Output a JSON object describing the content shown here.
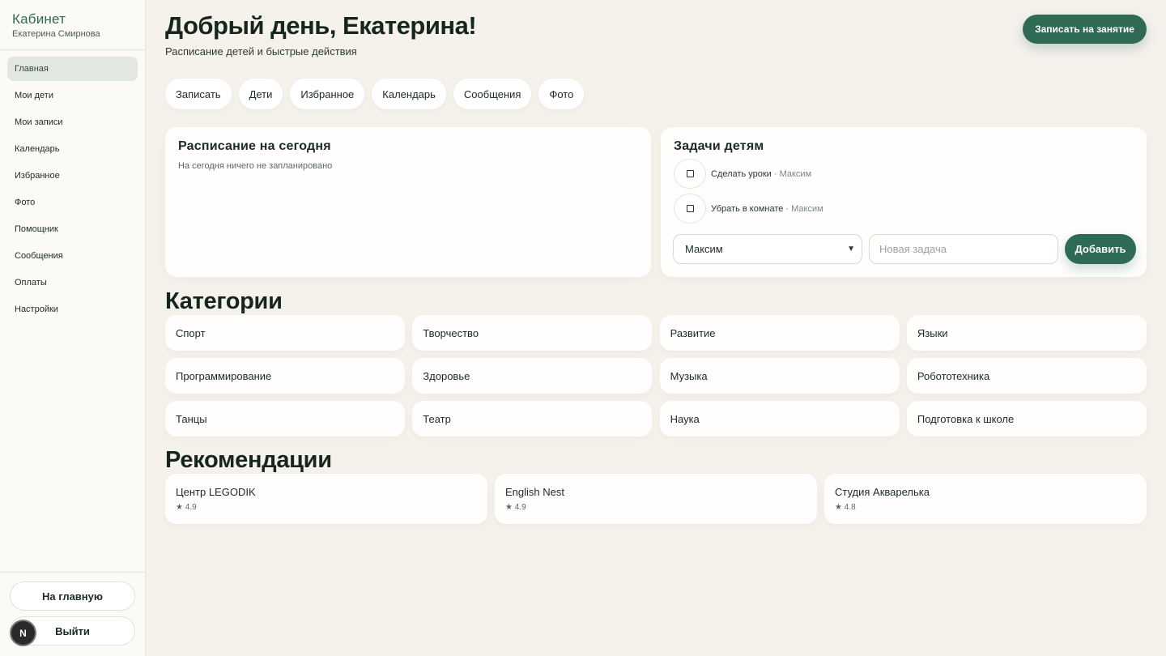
{
  "sidebar": {
    "title": "Кабинет",
    "user": "Екатерина Смирнова",
    "items": [
      {
        "label": "Главная",
        "active": true
      },
      {
        "label": "Мои дети"
      },
      {
        "label": "Мои записи"
      },
      {
        "label": "Календарь"
      },
      {
        "label": "Избранное"
      },
      {
        "label": "Фото"
      },
      {
        "label": "Помощник"
      },
      {
        "label": "Сообщения"
      },
      {
        "label": "Оплаты"
      },
      {
        "label": "Настройки"
      }
    ],
    "home_button": "На главную",
    "logout_button": "Выйти",
    "badge": "N"
  },
  "header": {
    "greeting": "Добрый день, Екатерина!",
    "subtitle": "Расписание детей и быстрые действия",
    "cta": "Записать на занятие"
  },
  "quick_actions": [
    "Записать",
    "Дети",
    "Избранное",
    "Календарь",
    "Сообщения",
    "Фото"
  ],
  "schedule": {
    "title": "Расписание на сегодня",
    "empty": "На сегодня ничего не запланировано"
  },
  "tasks": {
    "title": "Задачи детям",
    "items": [
      {
        "text": "Сделать уроки",
        "child": " · Максим"
      },
      {
        "text": "Убрать в комнате",
        "child": " · Максим"
      }
    ],
    "selected_child": "Максим",
    "new_task_placeholder": "Новая задача",
    "add_button": "Добавить"
  },
  "categories": {
    "title": "Категории",
    "items": [
      "Спорт",
      "Творчество",
      "Развитие",
      "Языки",
      "Программирование",
      "Здоровье",
      "Музыка",
      "Робототехника",
      "Танцы",
      "Театр",
      "Наука",
      "Подготовка к школе"
    ]
  },
  "recommendations": {
    "title": "Рекомендации",
    "items": [
      {
        "name": "Центр LEGODIK",
        "rating": "★ 4.9"
      },
      {
        "name": "English Nest",
        "rating": "★ 4.9"
      },
      {
        "name": "Студия Акварелька",
        "rating": "★ 4.8"
      }
    ]
  },
  "colors": {
    "accent": "#2f6a55",
    "background": "#f5f2ec"
  }
}
